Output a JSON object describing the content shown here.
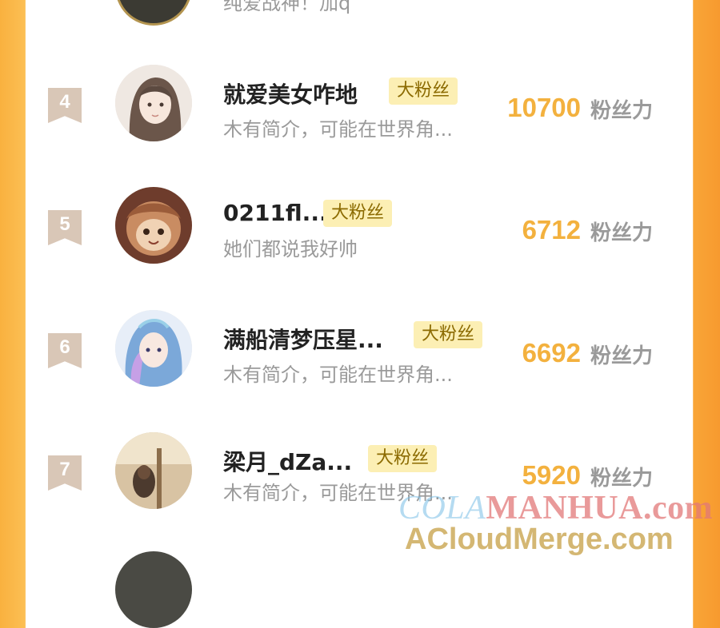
{
  "top_partial": {
    "bio": "纯爱战神！加q"
  },
  "rows": [
    {
      "rank": "4",
      "name": "就爱美女咋地",
      "badge": "大粉丝",
      "bio": "木有简介，可能在世界角...",
      "score": "10700",
      "unit": "粉丝力"
    },
    {
      "rank": "5",
      "name": "0211fl...",
      "badge": "大粉丝",
      "bio": "她们都说我好帅",
      "score": "6712",
      "unit": "粉丝力"
    },
    {
      "rank": "6",
      "name": "满船清梦压星...",
      "badge": "大粉丝",
      "bio": "木有简介，可能在世界角...",
      "score": "6692",
      "unit": "粉丝力"
    },
    {
      "rank": "7",
      "name": "梁月_dZa...",
      "badge": "大粉丝",
      "bio": "木有简介，可能在世界角...",
      "score": "5920",
      "unit": "粉丝力"
    }
  ],
  "watermark": {
    "line1_a": "COLA",
    "line1_b": "MANHUA.com",
    "line2": "ACloudMerge.com"
  },
  "colors": {
    "accent": "#f3b13e",
    "badge_bg": "#fcefb4",
    "rank_bg": "#d9c7b7",
    "side_orange": "#f9a537"
  }
}
